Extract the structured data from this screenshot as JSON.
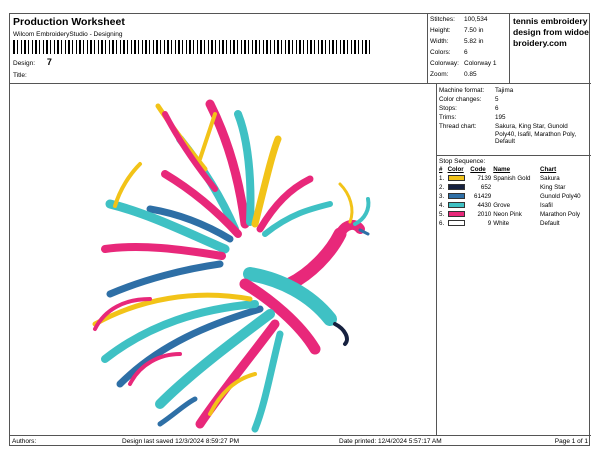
{
  "header": {
    "title": "Production Worksheet",
    "subtitle": "Wilcom EmbroideryStudio - Designing",
    "design_label": "Design:",
    "design_value": "7",
    "title_label": "Title:"
  },
  "stats": [
    {
      "label": "Stitches:",
      "value": "100,534"
    },
    {
      "label": "Height:",
      "value": "7.50 in"
    },
    {
      "label": "Width:",
      "value": "5.82 in"
    },
    {
      "label": "Colors:",
      "value": "6"
    },
    {
      "label": "Colorway:",
      "value": "Colorway 1"
    },
    {
      "label": "Zoom:",
      "value": "0.85"
    }
  ],
  "promo": "tennis embroidery design from widoebroidery.com",
  "machine": [
    {
      "label": "Machine format:",
      "value": "Tajima"
    },
    {
      "label": "Color changes:",
      "value": "5"
    },
    {
      "label": "Stops:",
      "value": "6"
    },
    {
      "label": "Trims:",
      "value": "195"
    },
    {
      "label": "Thread chart:",
      "value": "Sakura, King Star, Gunold Poly40, Isafil, Marathon Poly, Default"
    }
  ],
  "sequence": {
    "title": "Stop Sequence:",
    "headers": {
      "num": "#",
      "color": "Color",
      "code": "Code",
      "name": "Name",
      "chart": "Chart"
    },
    "rows": [
      {
        "num": "1.",
        "color": "#f2c318",
        "code": "7139",
        "name": "Spanish Gold",
        "chart": "Sakura"
      },
      {
        "num": "2.",
        "color": "#16213f",
        "code": "652",
        "name": "",
        "chart": "King Star"
      },
      {
        "num": "3.",
        "color": "#2e6fa6",
        "code": "61429",
        "name": "",
        "chart": "Gunold Poly40"
      },
      {
        "num": "4.",
        "color": "#3fc1c4",
        "code": "4430",
        "name": "Grove",
        "chart": "Isafil"
      },
      {
        "num": "5.",
        "color": "#e8287a",
        "code": "2010",
        "name": "Neon Pink",
        "chart": "Marathon Poly"
      },
      {
        "num": "6.",
        "color": "#ffffff",
        "code": "9",
        "name": "White",
        "chart": "Default"
      }
    ]
  },
  "footer": {
    "authors_label": "Authors:",
    "saved": "Design last saved   12/3/2024 8:59:27 PM",
    "printed": "Date printed: 12/4/2024 5:57:17 AM",
    "page": "Page 1 of 1"
  },
  "colors": {
    "pink": "#e8287a",
    "teal": "#3fc1c4",
    "gold": "#f2c318",
    "blue": "#2e6fa6",
    "navy": "#16213f"
  },
  "artwork": {
    "icon": "phoenix-embroidery"
  }
}
